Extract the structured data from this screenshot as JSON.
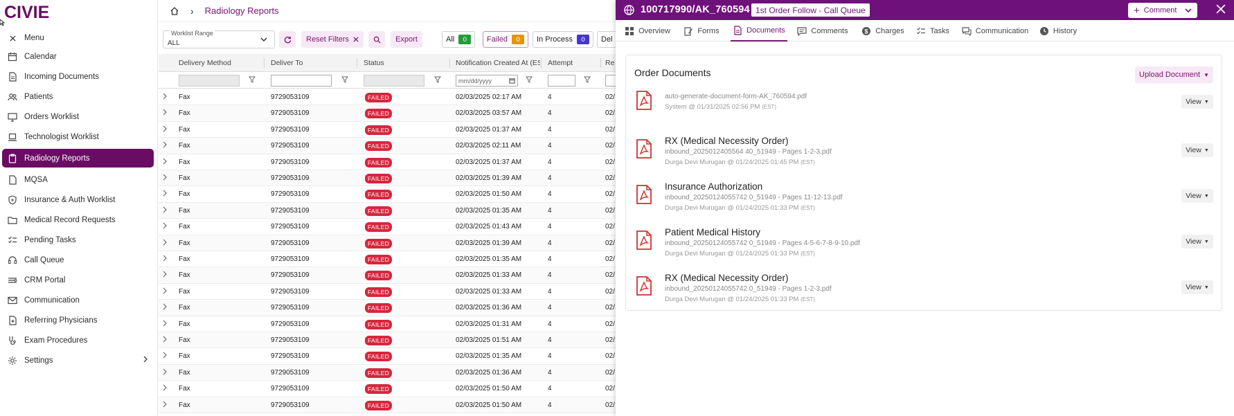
{
  "app": {
    "logo_text": "CIVIE",
    "menu_label": "Menu"
  },
  "sidebar": {
    "items": [
      {
        "label": "Calendar",
        "icon": "calendar-icon"
      },
      {
        "label": "Incoming Documents",
        "icon": "document-icon"
      },
      {
        "label": "Patients",
        "icon": "users-icon"
      },
      {
        "label": "Orders Worklist",
        "icon": "monitor-icon"
      },
      {
        "label": "Technologist Worklist",
        "icon": "laptop-icon"
      },
      {
        "label": "Radiology Reports",
        "icon": "clipboard-icon",
        "active": true
      },
      {
        "label": "MQSA",
        "icon": "file-icon"
      },
      {
        "label": "Insurance & Auth Worklist",
        "icon": "shield-icon"
      },
      {
        "label": "Medical Record Requests",
        "icon": "folder-icon"
      },
      {
        "label": "Pending Tasks",
        "icon": "tasks-icon"
      },
      {
        "label": "Call Queue",
        "icon": "headset-icon"
      },
      {
        "label": "CRM Portal",
        "icon": "crm-icon"
      },
      {
        "label": "Communication",
        "icon": "mail-icon"
      },
      {
        "label": "Referring Physicians",
        "icon": "physician-icon"
      },
      {
        "label": "Exam Procedures",
        "icon": "procedure-icon"
      },
      {
        "label": "Settings",
        "icon": "gear-icon"
      }
    ]
  },
  "breadcrumb": {
    "title": "Radiology Reports"
  },
  "filters": {
    "worklist_label": "Worklist Range",
    "worklist_value": "ALL",
    "reset_label": "Reset Filters",
    "export_label": "Export",
    "pills": [
      {
        "label": "All",
        "count": "0",
        "color": "#1f9d3a"
      },
      {
        "label": "Failed",
        "count": "0",
        "color": "#e8930c"
      },
      {
        "label": "In Process",
        "count": "0",
        "color": "#4338ca"
      },
      {
        "label": "Del"
      }
    ]
  },
  "table": {
    "columns": [
      "Delivery Method",
      "Deliver To",
      "Status",
      "Notification Created At (EST)",
      "Attempt",
      "Re"
    ],
    "date_placeholder": "mm/dd/yyyy",
    "rows": [
      {
        "method": "Fax",
        "to": "9729053109",
        "status": "FAILED",
        "created": "02/03/2025 02:17 AM",
        "attempt": "4",
        "re": "02/"
      },
      {
        "method": "Fax",
        "to": "9729053109",
        "status": "FAILED",
        "created": "02/03/2025 03:57 AM",
        "attempt": "4",
        "re": "02/"
      },
      {
        "method": "Fax",
        "to": "9729053109",
        "status": "FAILED",
        "created": "02/03/2025 01:37 AM",
        "attempt": "4",
        "re": "02/"
      },
      {
        "method": "Fax",
        "to": "9729053109",
        "status": "FAILED",
        "created": "02/03/2025 02:11 AM",
        "attempt": "4",
        "re": "02/"
      },
      {
        "method": "Fax",
        "to": "9729053109",
        "status": "FAILED",
        "created": "02/03/2025 01:37 AM",
        "attempt": "4",
        "re": "02/"
      },
      {
        "method": "Fax",
        "to": "9729053109",
        "status": "FAILED",
        "created": "02/03/2025 01:39 AM",
        "attempt": "4",
        "re": "02/"
      },
      {
        "method": "Fax",
        "to": "9729053109",
        "status": "FAILED",
        "created": "02/03/2025 01:50 AM",
        "attempt": "4",
        "re": "02/"
      },
      {
        "method": "Fax",
        "to": "9729053109",
        "status": "FAILED",
        "created": "02/03/2025 01:35 AM",
        "attempt": "4",
        "re": "02/"
      },
      {
        "method": "Fax",
        "to": "9729053109",
        "status": "FAILED",
        "created": "02/03/2025 01:43 AM",
        "attempt": "4",
        "re": "02/"
      },
      {
        "method": "Fax",
        "to": "9729053109",
        "status": "FAILED",
        "created": "02/03/2025 01:39 AM",
        "attempt": "4",
        "re": "02/"
      },
      {
        "method": "Fax",
        "to": "9729053109",
        "status": "FAILED",
        "created": "02/03/2025 01:35 AM",
        "attempt": "4",
        "re": "02/"
      },
      {
        "method": "Fax",
        "to": "9729053109",
        "status": "FAILED",
        "created": "02/03/2025 01:33 AM",
        "attempt": "4",
        "re": "02/"
      },
      {
        "method": "Fax",
        "to": "9729053109",
        "status": "FAILED",
        "created": "02/03/2025 01:33 AM",
        "attempt": "4",
        "re": "02/"
      },
      {
        "method": "Fax",
        "to": "9729053109",
        "status": "FAILED",
        "created": "02/03/2025 01:36 AM",
        "attempt": "4",
        "re": "02/"
      },
      {
        "method": "Fax",
        "to": "9729053109",
        "status": "FAILED",
        "created": "02/03/2025 01:31 AM",
        "attempt": "4",
        "re": "02/"
      },
      {
        "method": "Fax",
        "to": "9729053109",
        "status": "FAILED",
        "created": "02/03/2025 01:51 AM",
        "attempt": "4",
        "re": "02/"
      },
      {
        "method": "Fax",
        "to": "9729053109",
        "status": "FAILED",
        "created": "02/03/2025 01:35 AM",
        "attempt": "4",
        "re": "02/"
      },
      {
        "method": "Fax",
        "to": "9729053109",
        "status": "FAILED",
        "created": "02/03/2025 01:36 AM",
        "attempt": "4",
        "re": "02/"
      },
      {
        "method": "Fax",
        "to": "9729053109",
        "status": "FAILED",
        "created": "02/03/2025 01:50 AM",
        "attempt": "4",
        "re": "02/"
      },
      {
        "method": "Fax",
        "to": "9729053109",
        "status": "FAILED",
        "created": "02/03/2025 01:50 AM",
        "attempt": "4",
        "re": "02/"
      }
    ]
  },
  "drawer": {
    "title": "100717990/AK_760594",
    "chip": "1st Order Follow - Call Queue",
    "comment_label": "Comment",
    "tabs": [
      {
        "label": "Overview",
        "icon": "grid-icon"
      },
      {
        "label": "Forms",
        "icon": "forms-icon"
      },
      {
        "label": "Documents",
        "icon": "document-icon",
        "active": true
      },
      {
        "label": "Comments",
        "icon": "comment-icon"
      },
      {
        "label": "Charges",
        "icon": "dollar-icon"
      },
      {
        "label": "Tasks",
        "icon": "tasks-icon"
      },
      {
        "label": "Communication",
        "icon": "chat-icon"
      },
      {
        "label": "History",
        "icon": "clock-icon"
      }
    ],
    "section_title": "Order Documents",
    "upload_label": "Upload Document",
    "view_label": "View",
    "documents": [
      {
        "name": "",
        "file": "auto-generate-document-form-AK_760594.pdf",
        "meta": "System @ 01/31/2025 02:56 PM",
        "tz": "(EST)"
      },
      {
        "name": "RX (Medical Necessity Order)",
        "file": "inbound_2025012405564 40_51949 - Pages 1-2-3.pdf",
        "meta": "Durga Devi Murugan @ 01/24/2025 01:45 PM",
        "tz": "(EST)"
      },
      {
        "name": "Insurance Authorization",
        "file": "inbound_20250124055742 0_51949 - Pages 11-12-13.pdf",
        "meta": "Durga Devi Murugan @ 01/24/2025 01:33 PM",
        "tz": "(EST)"
      },
      {
        "name": "Patient Medical History",
        "file": "inbound_20250124055742 0_51949 - Pages 4-5-6-7-8-9-10.pdf",
        "meta": "Durga Devi Murugan @ 01/24/2025 01:33 PM",
        "tz": "(EST)"
      },
      {
        "name": "RX (Medical Necessity Order)",
        "file": "inbound_20250124055742 0_51949 - Pages 1-2-3.pdf",
        "meta": "Durga Devi Murugan @ 01/24/2025 01:33 PM",
        "tz": "(EST)"
      }
    ]
  }
}
